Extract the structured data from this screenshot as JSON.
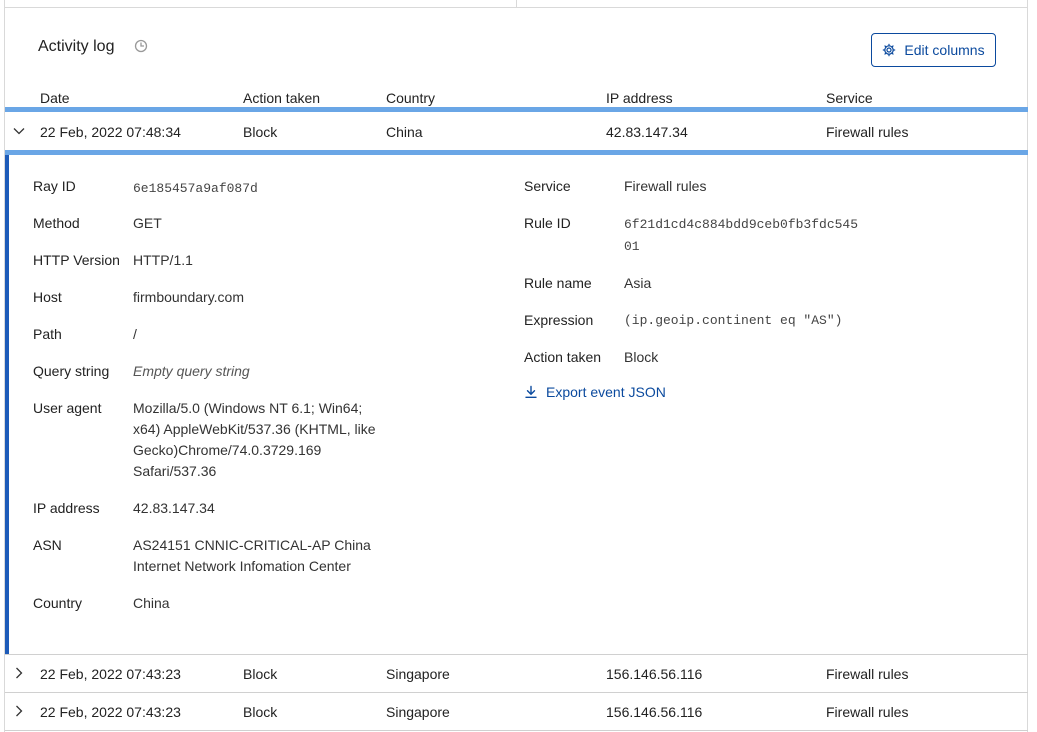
{
  "panel": {
    "title": "Activity log",
    "edit_columns_label": "Edit columns"
  },
  "columns": [
    "Date",
    "Action taken",
    "Country",
    "IP address",
    "Service"
  ],
  "rows": [
    {
      "date": "22 Feb, 2022 07:48:34",
      "action": "Block",
      "country": "China",
      "ip": "42.83.147.34",
      "service": "Firewall rules",
      "expanded": true
    },
    {
      "date": "22 Feb, 2022 07:43:23",
      "action": "Block",
      "country": "Singapore",
      "ip": "156.146.56.116",
      "service": "Firewall rules",
      "expanded": false
    },
    {
      "date": "22 Feb, 2022 07:43:23",
      "action": "Block",
      "country": "Singapore",
      "ip": "156.146.56.116",
      "service": "Firewall rules",
      "expanded": false
    }
  ],
  "details": {
    "left": [
      {
        "label": "Ray ID",
        "value": "6e185457a9af087d"
      },
      {
        "label": "Method",
        "value": "GET"
      },
      {
        "label": "HTTP Version",
        "value": "HTTP/1.1"
      },
      {
        "label": "Host",
        "value": "firmboundary.com"
      },
      {
        "label": "Path",
        "value": "/"
      },
      {
        "label": "Query string",
        "value": "Empty query string"
      },
      {
        "label": "User agent",
        "value_lines": [
          "Mozilla/5.0 (Windows NT 6.1; Win64;",
          "x64) AppleWebKit/537.36 (KHTML, like",
          "Gecko)Chrome/74.0.3729.169",
          "Safari/537.36"
        ]
      },
      {
        "label": "IP address",
        "value": "42.83.147.34"
      },
      {
        "label": "ASN",
        "value_lines": [
          "AS24151 CNNIC-CRITICAL-AP China",
          "Internet Network Infomation Center"
        ]
      },
      {
        "label": "Country",
        "value": "China"
      }
    ],
    "right": [
      {
        "label": "Service",
        "value": "Firewall rules"
      },
      {
        "label": "Rule ID",
        "value_lines": [
          "6f21d1cd4c884bdd9ceb0fb3fdc545",
          "01"
        ]
      },
      {
        "label": "Rule name",
        "value": "Asia"
      },
      {
        "label": "Expression",
        "value": "(ip.geoip.continent eq \"AS\")"
      },
      {
        "label": "Action taken",
        "value": "Block"
      }
    ],
    "export_label": "Export event JSON"
  },
  "colors": {
    "accent": "#0b4a9e",
    "selected_line": "#6aa6e6",
    "expanded_bar": "#1d5bb8"
  }
}
